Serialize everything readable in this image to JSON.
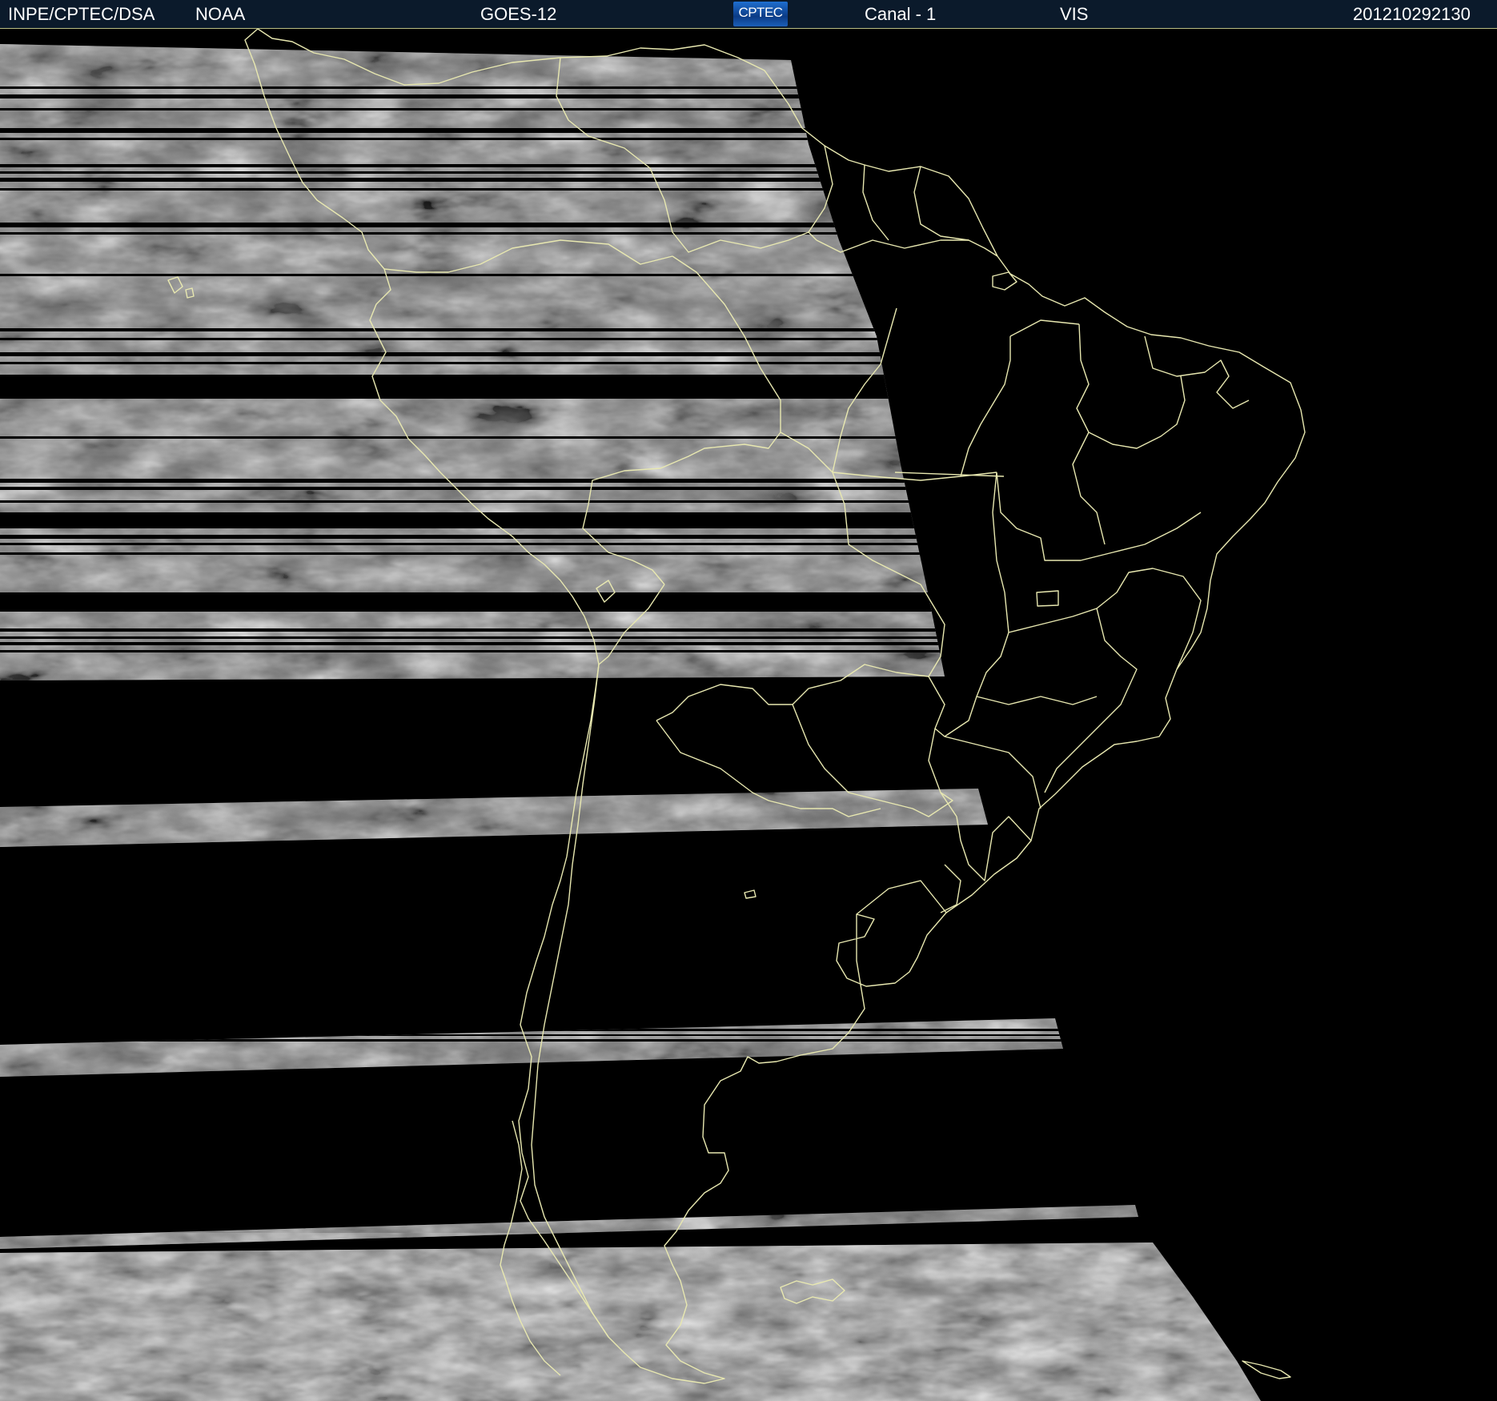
{
  "header": {
    "org": "INPE/CPTEC/DSA",
    "agency": "NOAA",
    "satellite": "GOES-12",
    "logo_text": "CPTEC",
    "channel": "Canal - 1",
    "band": "VIS",
    "timestamp": "201210292130"
  },
  "colors": {
    "header_bg": "#0b1a2b",
    "header_text": "#ffffff",
    "border_lines": "#e8e8b0",
    "background": "#000000",
    "cloud_gray": "#8a8a8a"
  },
  "icons": {
    "logo": "cptec-logo"
  }
}
